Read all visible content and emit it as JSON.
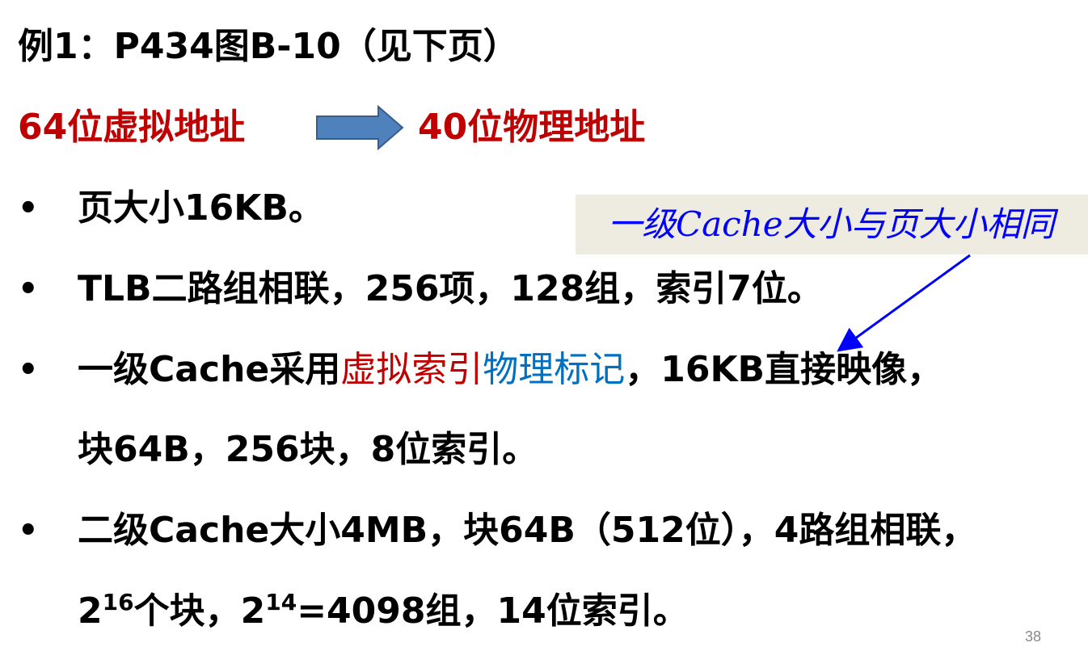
{
  "title": "例1：P434图B-10（见下页）",
  "address": {
    "virtual": "64位虚拟地址",
    "physical": "40位物理地址",
    "arrow_color": "#4f81bd"
  },
  "callout": {
    "text": "一级Cache大小与页大小相同",
    "text_color": "#0000ff",
    "bg_color": "#eeece1"
  },
  "bullets": [
    {
      "prefix": "页大小16KB。"
    },
    {
      "prefix": "TLB二路组相联，256项，128组，索引7位。"
    },
    {
      "prefix": "一级Cache采用",
      "red": "虚拟索引",
      "blue": "物理标记",
      "suffix": "，16KB直接映像，",
      "line2": "块64B，256块，8位索引。"
    },
    {
      "prefix": "二级Cache大小4MB，块64B（512位），4路组相联，",
      "line2_a": "2",
      "line2_sup1": "16",
      "line2_b": "个块，2",
      "line2_sup2": "14",
      "line2_c": "=4098组，14位索引。"
    }
  ],
  "bullet_symbol": "•",
  "page_number": "38"
}
